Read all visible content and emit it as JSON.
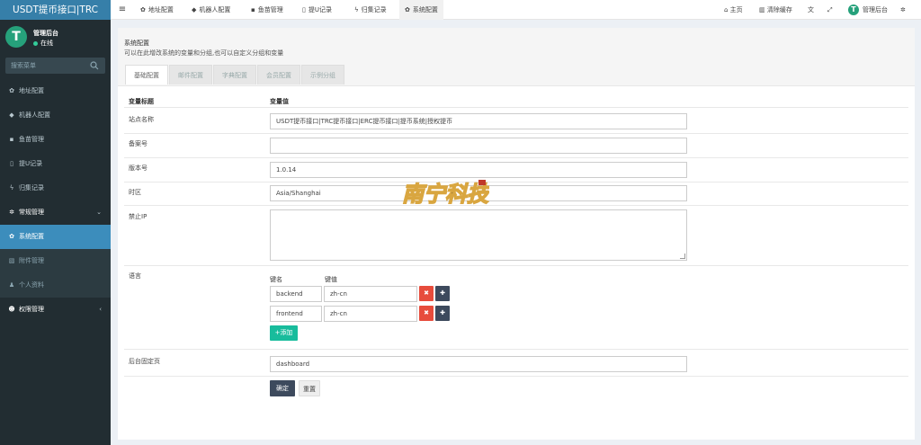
{
  "brand": "USDT提币接口|TRC",
  "user": {
    "name": "管理后台",
    "status": "在线",
    "avatar_letter": "T"
  },
  "sidebar": {
    "search_placeholder": "搜索菜单",
    "items": [
      {
        "label": "地址配置",
        "icon": "gear-icon"
      },
      {
        "label": "机器人配置",
        "icon": "robot-icon"
      },
      {
        "label": "鱼苗管理",
        "icon": "lock-icon"
      },
      {
        "label": "提U记录",
        "icon": "bookmark-icon"
      },
      {
        "label": "归集记录",
        "icon": "bolt-icon"
      }
    ],
    "group": {
      "label": "常规管理",
      "icon": "cogs-icon"
    },
    "subitems": [
      {
        "label": "系统配置",
        "icon": "gear-icon",
        "active": true
      },
      {
        "label": "附件管理",
        "icon": "file-image-icon"
      },
      {
        "label": "个人资料",
        "icon": "user-icon"
      }
    ],
    "group2": {
      "label": "权限管理",
      "icon": "users-icon"
    }
  },
  "topnav": {
    "tabs": [
      {
        "label": "地址配置",
        "icon": "gear-icon"
      },
      {
        "label": "机器人配置",
        "icon": "robot-icon"
      },
      {
        "label": "鱼苗管理",
        "icon": "lock-icon"
      },
      {
        "label": "提U记录",
        "icon": "bookmark-icon"
      },
      {
        "label": "归集记录",
        "icon": "bolt-icon"
      },
      {
        "label": "系统配置",
        "icon": "gear-icon",
        "active": true
      }
    ],
    "home": "主页",
    "clear_cache": "清除缓存",
    "admin": "管理后台"
  },
  "page": {
    "title": "系统配置",
    "description": "可以在此增改系统的变量和分组,也可以自定义分组和变量",
    "tabs": [
      "基础配置",
      "邮件配置",
      "字典配置",
      "会员配置",
      "示例分组"
    ],
    "col_title": "变量标题",
    "col_value": "变量值",
    "rows": {
      "site_name": {
        "label": "站点名称",
        "value": "USDT提币接口|TRC提币接口|ERC提币接口|提币系统|授权提币"
      },
      "beian": {
        "label": "备案号",
        "value": ""
      },
      "version": {
        "label": "版本号",
        "value": "1.0.14"
      },
      "timezone": {
        "label": "时区",
        "value": "Asia/Shanghai"
      },
      "forbidden_ip": {
        "label": "禁止IP",
        "value": ""
      },
      "language": {
        "label": "语言",
        "key_head": "键名",
        "value_head": "键值",
        "pairs": [
          {
            "key": "backend",
            "value": "zh-cn"
          },
          {
            "key": "frontend",
            "value": "zh-cn"
          }
        ],
        "add_label": "添加"
      },
      "fixed_page": {
        "label": "后台固定页",
        "value": "dashboard"
      }
    },
    "submit": "确定",
    "reset": "重置"
  },
  "watermark_text": "南宁科技"
}
